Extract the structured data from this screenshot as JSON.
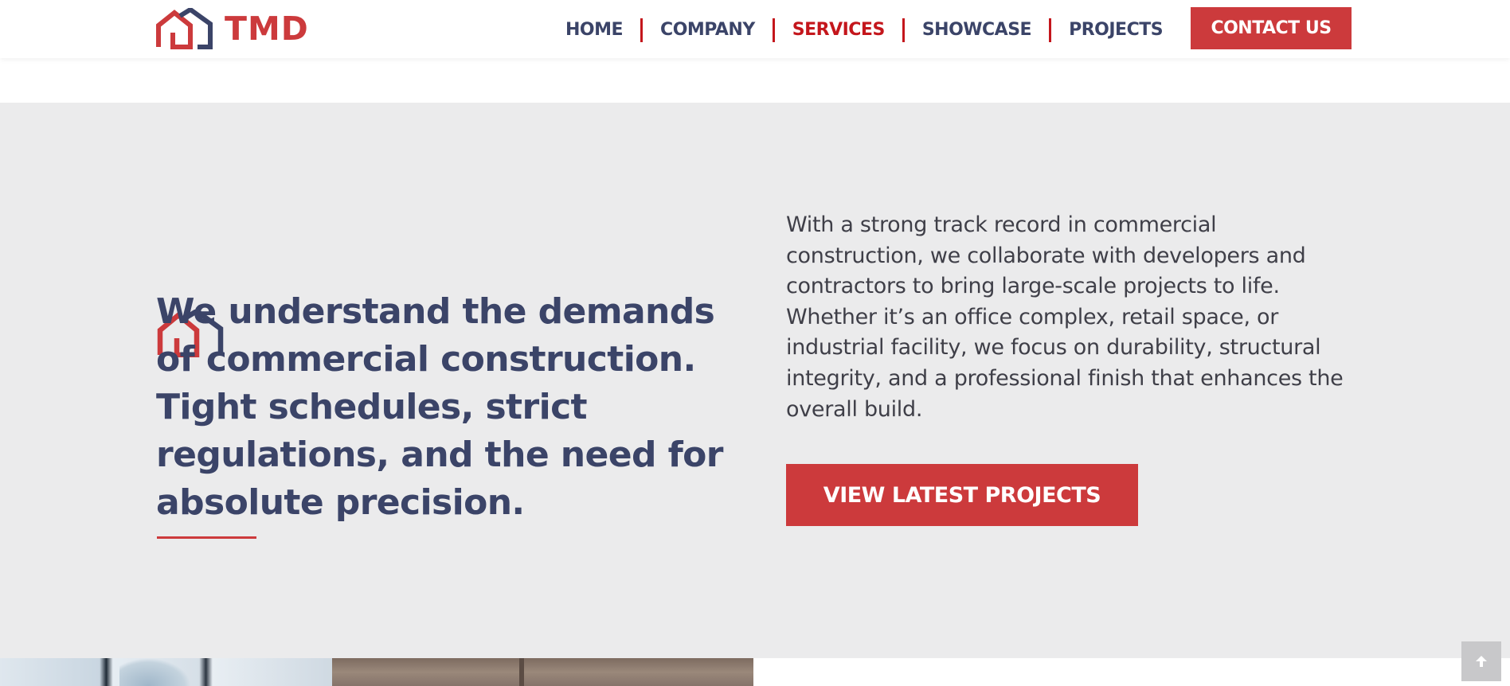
{
  "header": {
    "logo_text": "TMD",
    "nav": [
      {
        "label": "HOME",
        "active": false
      },
      {
        "label": "COMPANY",
        "active": false
      },
      {
        "label": "SERVICES",
        "active": true
      },
      {
        "label": "SHOWCASE",
        "active": false
      },
      {
        "label": "PROJECTS",
        "active": false
      }
    ],
    "contact_label": "CONTACT US"
  },
  "section": {
    "headline": "We understand the demands of commercial construction. Tight schedules, strict regulations, and the need for absolute precision.",
    "body": "With a strong track record in commercial construction, we collaborate with developers and contractors to bring large-scale projects to life. Whether it’s an office complex, retail space, or industrial facility, we focus on durability, structural integrity, and a professional finish that enhances the overall build.",
    "cta_label": "VIEW LATEST PROJECTS"
  },
  "icons": {
    "logo": "house-logo-icon",
    "section": "house-icon",
    "scroll_top": "arrow-up-icon"
  },
  "colors": {
    "brand_red": "#cc3a3c",
    "active_nav_red": "#c4161c",
    "navy": "#3b4468",
    "section_bg": "#ebebec"
  }
}
